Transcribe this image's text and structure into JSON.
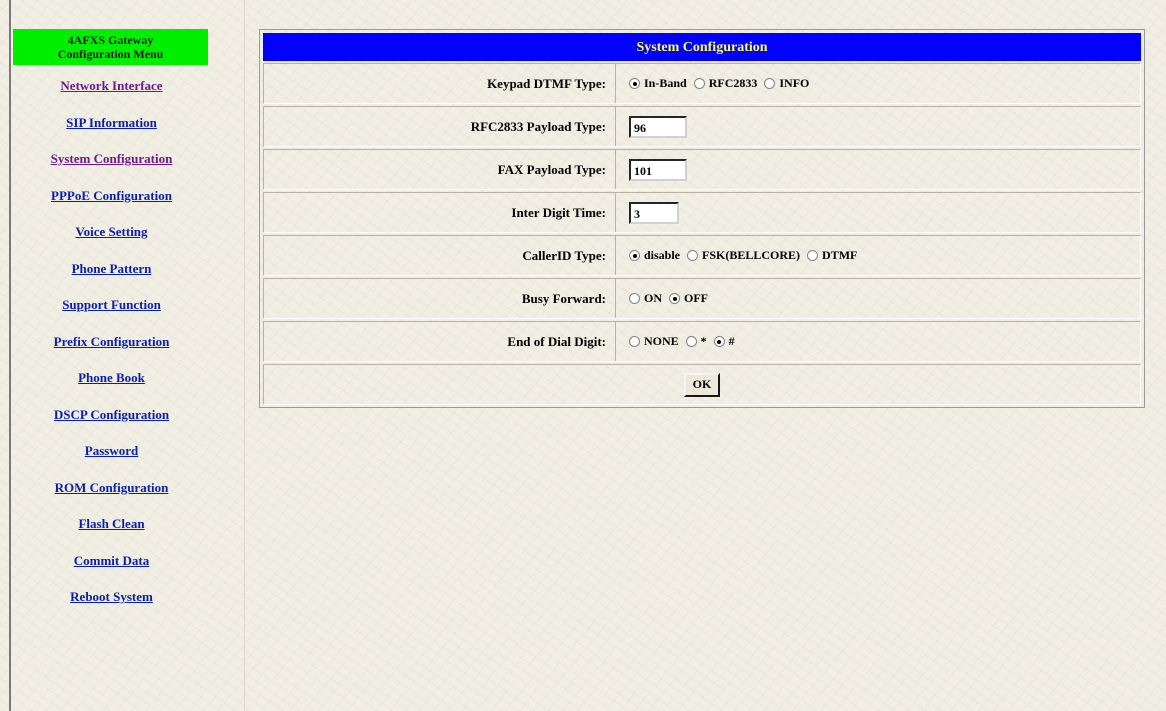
{
  "sidebar": {
    "header_line1": "4AFXS Gateway",
    "header_line2": "Configuration Menu",
    "items": [
      {
        "label": "Network Interface",
        "visited": true
      },
      {
        "label": "SIP Information",
        "visited": false
      },
      {
        "label": "System Configuration",
        "visited": true
      },
      {
        "label": "PPPoE Configuration",
        "visited": false
      },
      {
        "label": "Voice Setting",
        "visited": false
      },
      {
        "label": "Phone Pattern",
        "visited": false
      },
      {
        "label": "Support Function",
        "visited": false
      },
      {
        "label": "Prefix Configuration",
        "visited": false
      },
      {
        "label": "Phone Book",
        "visited": false
      },
      {
        "label": "DSCP Configuration",
        "visited": false
      },
      {
        "label": "Password",
        "visited": false
      },
      {
        "label": "ROM Configuration",
        "visited": false
      },
      {
        "label": "Flash Clean",
        "visited": false
      },
      {
        "label": "Commit Data",
        "visited": false
      },
      {
        "label": "Reboot System",
        "visited": false
      }
    ]
  },
  "panel": {
    "title": "System Configuration",
    "keypad_dtmf": {
      "label": "Keypad DTMF Type:",
      "options": [
        "In-Band",
        "RFC2833",
        "INFO"
      ],
      "selected": "In-Band"
    },
    "rfc2833_payload": {
      "label": "RFC2833 Payload Type:",
      "value": "96"
    },
    "fax_payload": {
      "label": "FAX Payload Type:",
      "value": "101"
    },
    "inter_digit": {
      "label": "Inter Digit Time:",
      "value": "3"
    },
    "callerid": {
      "label": "CallerID Type:",
      "options": [
        "disable",
        "FSK(BELLCORE)",
        "DTMF"
      ],
      "selected": "disable"
    },
    "busy_forward": {
      "label": "Busy Forward:",
      "options": [
        "ON",
        "OFF"
      ],
      "selected": "OFF"
    },
    "end_of_dial": {
      "label": "End of Dial Digit:",
      "options": [
        "NONE",
        "*",
        "#"
      ],
      "selected": "#"
    },
    "ok_label": "OK"
  },
  "colors": {
    "header_green": "#00ee00",
    "title_bar_blue": "#0000ff",
    "title_text_yellow": "#ffff44",
    "link_blue": "#0a1fa8",
    "link_visited": "#6a1a8a"
  }
}
